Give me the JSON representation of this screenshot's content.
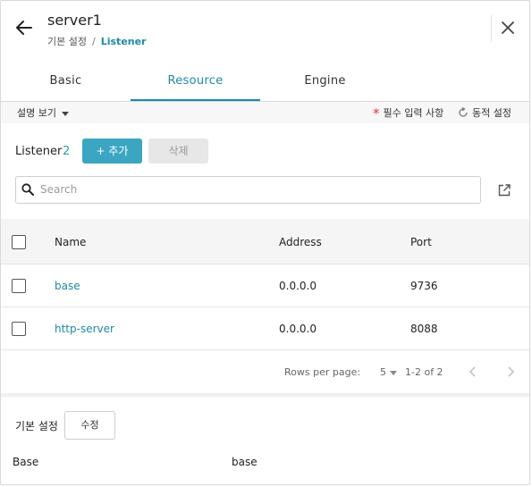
{
  "header": {
    "title": "server1",
    "breadcrumb": {
      "parent": "기본 설정",
      "separator": "/",
      "current": "Listener"
    }
  },
  "tabs": [
    {
      "label": "Basic",
      "active": false
    },
    {
      "label": "Resource",
      "active": true
    },
    {
      "label": "Engine",
      "active": false
    }
  ],
  "options": {
    "description_toggle": "설명 보기",
    "required_marker": "*",
    "required_label": "필수 입력 사항",
    "dynamic_label": "동적 설정"
  },
  "listener": {
    "label": "Listener",
    "count": "2",
    "add_label": "+ 추가",
    "delete_label": "삭제"
  },
  "search": {
    "placeholder": "Search",
    "value": ""
  },
  "table": {
    "columns": [
      "Name",
      "Address",
      "Port"
    ],
    "rows": [
      {
        "name": "base",
        "address": "0.0.0.0",
        "port": "9736"
      },
      {
        "name": "http-server",
        "address": "0.0.0.0",
        "port": "8088"
      }
    ]
  },
  "pagination": {
    "rows_per_page_label": "Rows per page:",
    "rows_per_page": "5",
    "range": "1-2 of 2"
  },
  "basic_settings": {
    "label": "기본 설정",
    "edit_label": "수정",
    "key": "Base",
    "value": "base"
  },
  "colors": {
    "accent": "#1a8aa8",
    "add_button": "#3aa6c2",
    "count": "#1aa89e",
    "required": "#e53935"
  },
  "icons": [
    "arrow-left-icon",
    "close-icon",
    "caret-down-icon",
    "refresh-icon",
    "search-icon",
    "external-link-icon",
    "chevron-left-icon",
    "chevron-right-icon"
  ]
}
